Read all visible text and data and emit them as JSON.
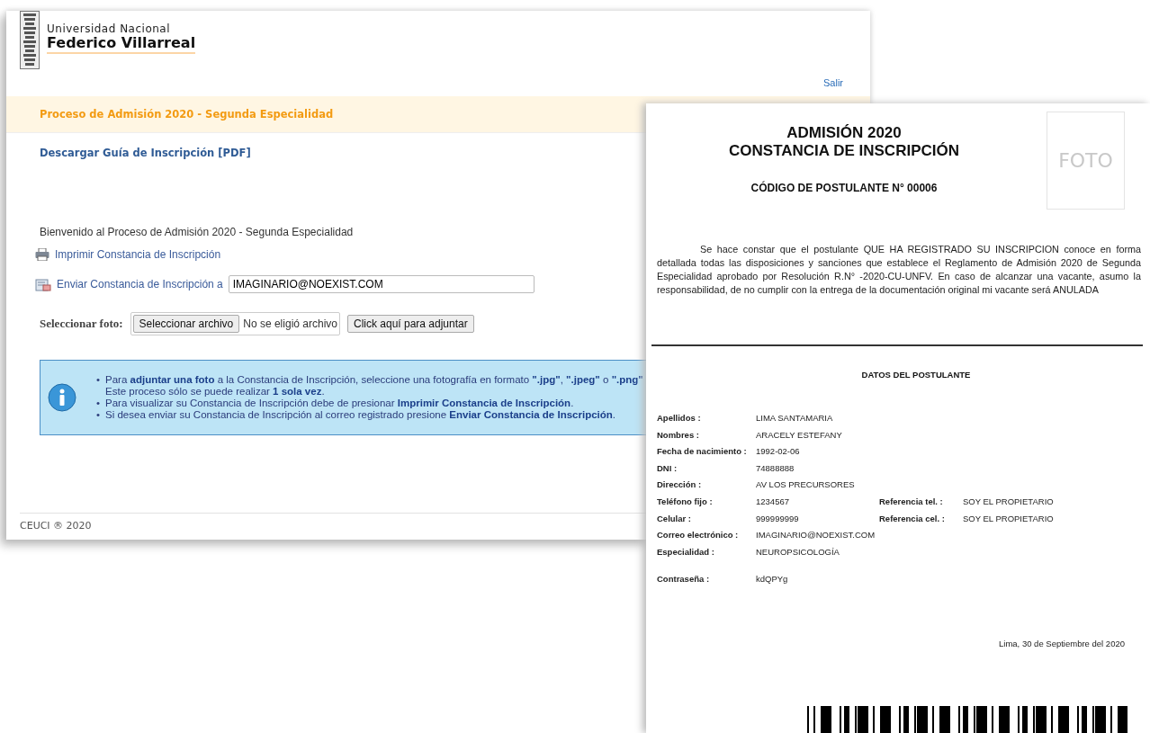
{
  "portal": {
    "logo": {
      "line1": "Universidad Nacional",
      "line2": "Federico Villarreal"
    },
    "logout_link": "Salir",
    "banner_title": "Proceso de Admisión 2020 - Segunda Especialidad",
    "guide_link": "Descargar Guía de Inscripción [PDF]",
    "welcome": "Bienvenido al Proceso de Admisión 2020 - Segunda Especialidad",
    "print_link": "Imprimir Constancia de Inscripción",
    "send_label": "Enviar Constancia de Inscripción a",
    "send_email": {
      "value": "IMAGINARIO@NOEXIST.COM"
    },
    "photo_label": "Seleccionar foto:",
    "file_button": "Seleccionar archivo",
    "file_status": "No se eligió archivo",
    "attach_button": "Click aquí para adjuntar",
    "info_items": [
      {
        "marker": "•",
        "text": "Para **adjuntar una foto** a la Constancia de Inscripción, seleccione una fotografía en formato **\".jpg\"**, **\".jpeg\"** o **\".png\"**",
        "note": "Este proceso sólo se puede realizar **1 sola vez**."
      },
      {
        "marker": "•",
        "text": "Para visualizar su Constancia de Inscripción debe de presionar **Imprimir Constancia de Inscripción**."
      },
      {
        "marker": "•",
        "text": "Si desea enviar su Constancia de Inscripción al correo registrado presione **Enviar Constancia de Inscripción**."
      }
    ],
    "footer": "CEUCI ® 2020"
  },
  "document": {
    "title_lines": [
      "ADMISIÓN 2020",
      "CONSTANCIA DE INSCRIPCIÓN"
    ],
    "photo_placeholder": "FOTO",
    "code": "CÓDIGO DE POSTULANTE N° 00006",
    "paragraph": "Se hace constar que el postulante QUE HA REGISTRADO SU INSCRIPCION conoce en forma detallada todas las disposiciones y sanciones que establece el Reglamento de Admisión 2020 de Segunda Especialidad aprobado por Resolución R.N° -2020-CU-UNFV. En caso de alcanzar una vacante, asumo la responsabilidad, de no cumplir con la entrega de la documentación original mi vacante será ANULADA",
    "section_title": "DATOS DEL POSTULANTE",
    "fields": [
      {
        "label": "Apellidos :",
        "value": "LIMA SANTAMARIA"
      },
      {
        "label": "Nombres :",
        "value": "ARACELY ESTEFANY"
      },
      {
        "label": "Fecha de nacimiento :",
        "value": "1992-02-06"
      },
      {
        "label": "DNI :",
        "value": "74888888"
      },
      {
        "label": "Dirección :",
        "value": "AV LOS PRECURSORES"
      },
      {
        "label": "Teléfono fijo :",
        "value": "1234567",
        "ref_label": "Referencia tel. :",
        "ref_value": "SOY EL PROPIETARIO"
      },
      {
        "label": "Celular :",
        "value": "999999999",
        "ref_label": "Referencia cel. :",
        "ref_value": "SOY EL PROPIETARIO"
      },
      {
        "label": "Correo electrónico :",
        "value": "IMAGINARIO@NOEXIST.COM"
      },
      {
        "label": "Especialidad :",
        "value": "NEUROPSICOLOGÍA"
      }
    ],
    "password": {
      "label": "Contraseña :",
      "value": "kdQPYg"
    },
    "date": "Lima, 30 de Septiembre del 2020"
  }
}
